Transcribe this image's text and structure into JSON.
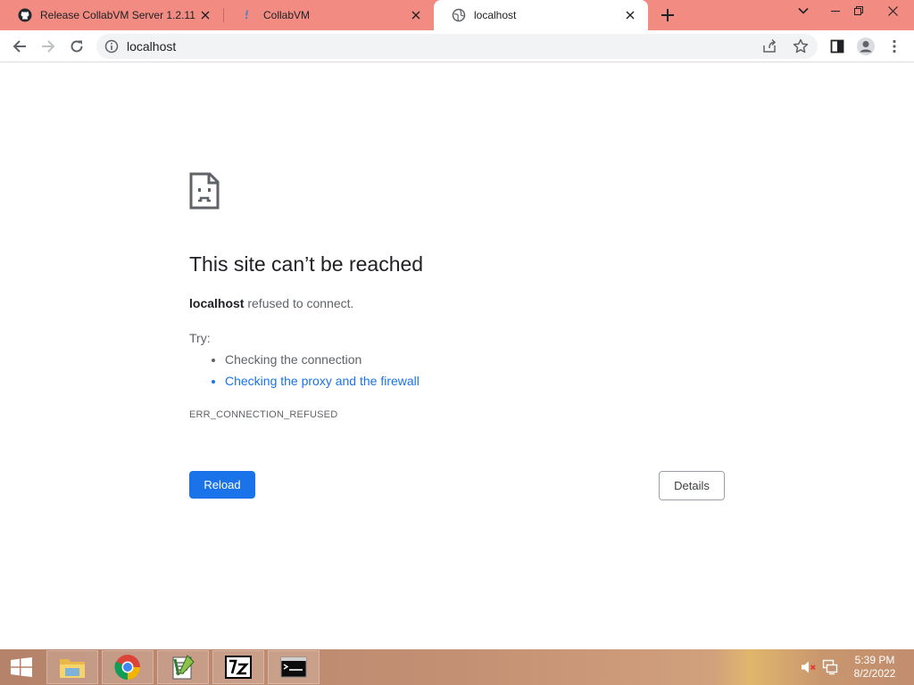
{
  "browser": {
    "tabs": [
      {
        "title": "Release CollabVM Server 1.2.11",
        "icon": "github-icon"
      },
      {
        "title": "CollabVM",
        "icon": "collabvm-icon"
      },
      {
        "title": "localhost",
        "icon": "globe-icon",
        "active": true
      }
    ],
    "address": "localhost",
    "colors": {
      "tabstrip": "#f28b82",
      "active_tab": "#ffffff",
      "accent": "#1a73e8"
    }
  },
  "error_page": {
    "icon": "sad-page-icon",
    "heading": "This site can’t be reached",
    "host": "localhost",
    "message_rest": " refused to connect.",
    "try_label": "Try:",
    "suggestions": [
      "Checking the connection",
      "Checking the proxy and the firewall"
    ],
    "error_code": "ERR_CONNECTION_REFUSED",
    "reload_label": "Reload",
    "details_label": "Details"
  },
  "taskbar": {
    "apps": [
      "file-explorer-icon",
      "chrome-icon",
      "notepad-plus-icon",
      "7zip-icon",
      "command-prompt-icon"
    ],
    "time": "5:39 PM",
    "date": "8/2/2022"
  }
}
